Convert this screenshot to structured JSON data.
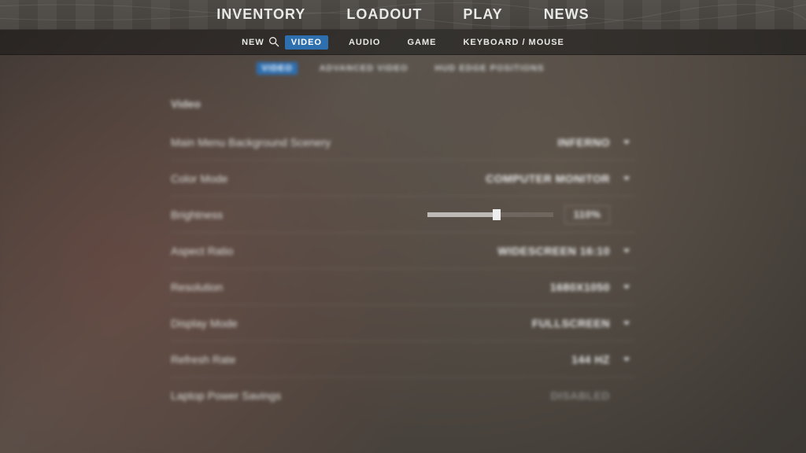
{
  "topnav": [
    "INVENTORY",
    "LOADOUT",
    "PLAY",
    "NEWS"
  ],
  "subtabs": [
    "NEW",
    "VIDEO",
    "AUDIO",
    "GAME",
    "KEYBOARD / MOUSE"
  ],
  "subtabs_active_index": 1,
  "subsubtabs": [
    "VIDEO",
    "ADVANCED VIDEO",
    "HUD EDGE POSITIONS"
  ],
  "subsubtabs_active_index": 0,
  "section_title": "Video",
  "rows": {
    "scenery": {
      "label": "Main Menu Background Scenery",
      "value": "INFERNO"
    },
    "colormode": {
      "label": "Color Mode",
      "value": "COMPUTER MONITOR"
    },
    "brightness": {
      "label": "Brightness",
      "value": "110%",
      "percent": 55
    },
    "aspect": {
      "label": "Aspect Ratio",
      "value": "WIDESCREEN 16:10"
    },
    "resolution": {
      "label": "Resolution",
      "value": "1680X1050"
    },
    "display": {
      "label": "Display Mode",
      "value": "FULLSCREEN"
    },
    "refresh": {
      "label": "Refresh Rate",
      "value": "144 HZ"
    },
    "power": {
      "label": "Laptop Power Savings",
      "value": "DISABLED"
    }
  }
}
